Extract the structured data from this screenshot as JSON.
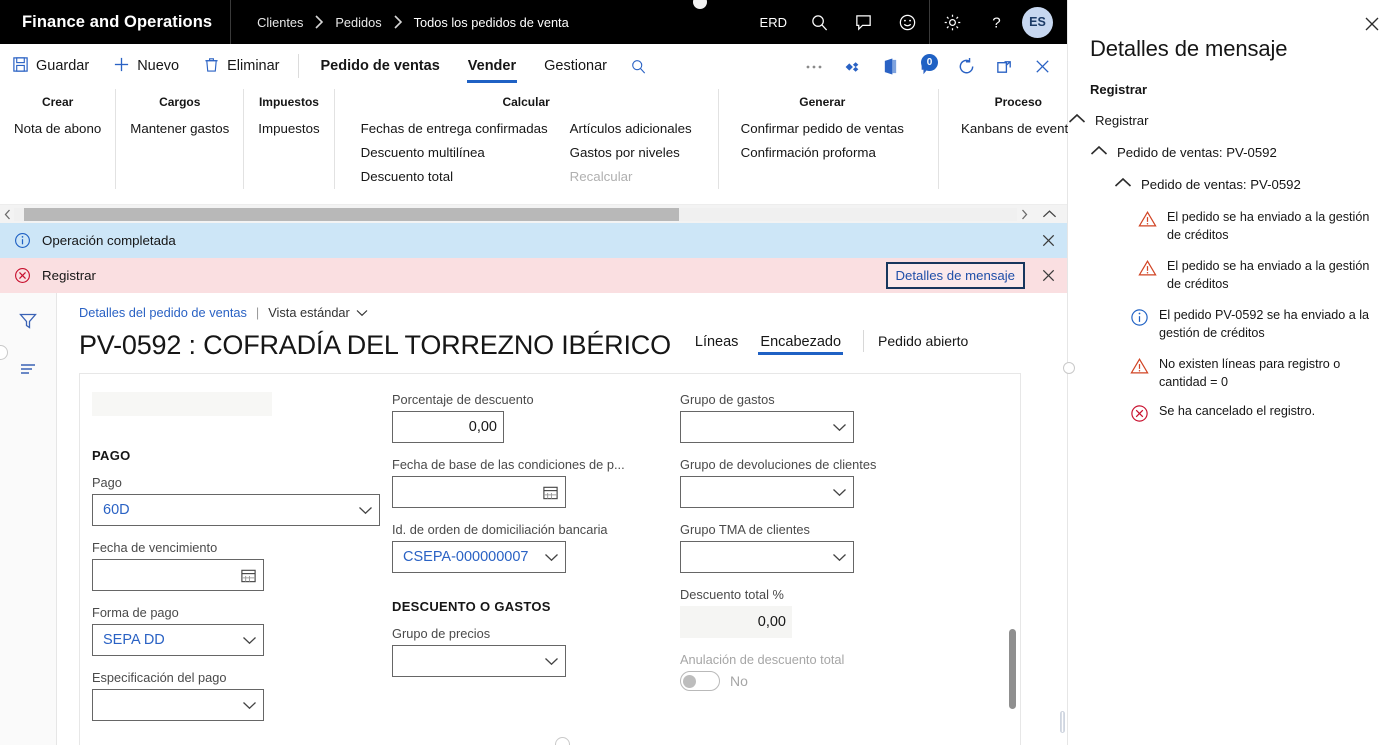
{
  "topbar": {
    "brand": "Finance and Operations",
    "breadcrumb": [
      "Clientes",
      "Pedidos",
      "Todos los pedidos de venta"
    ],
    "company": "ERD",
    "icons": [
      "search-icon",
      "feedback-icon",
      "smiley-icon",
      "settings-icon",
      "help-icon"
    ],
    "avatar_initials": "ES"
  },
  "actionpane": {
    "save": "Guardar",
    "new": "Nuevo",
    "delete": "Eliminar",
    "tabs": [
      {
        "label": "Pedido de ventas",
        "active": false
      },
      {
        "label": "Vender",
        "active": true
      },
      {
        "label": "Gestionar",
        "active": false
      }
    ],
    "notification_count": "0"
  },
  "ribbon": {
    "groups": [
      {
        "title": "Crear",
        "columns": [
          [
            "Nota de abono"
          ]
        ]
      },
      {
        "title": "Cargos",
        "columns": [
          [
            "Mantener gastos"
          ]
        ]
      },
      {
        "title": "Impuestos",
        "columns": [
          [
            "Impuestos"
          ]
        ]
      },
      {
        "title": "Calcular",
        "columns": [
          [
            "Fechas de entrega confirmadas",
            "Descuento multilínea",
            "Descuento total"
          ],
          [
            "Artículos adicionales",
            "Gastos por niveles",
            "Recalcular"
          ]
        ],
        "disabled": [
          "Recalcular"
        ]
      },
      {
        "title": "Generar",
        "columns": [
          [
            "Confirmar pedido de ventas",
            "Confirmación proforma"
          ]
        ]
      },
      {
        "title": "Proceso",
        "columns": [
          [
            "Kanbans de evento"
          ]
        ]
      }
    ]
  },
  "messagebars": [
    {
      "type": "info",
      "icon": "info-circle-icon",
      "text": "Operación completada",
      "bg": "#cde6f7"
    },
    {
      "type": "error",
      "icon": "error-circle-icon",
      "text": "Registrar",
      "bg": "#fadfe1",
      "action": "Detalles de mensaje"
    }
  ],
  "leftrail": {
    "icons": [
      "filter-icon",
      "lines-icon"
    ]
  },
  "page": {
    "caption_link": "Detalles del pedido de ventas",
    "caption_separator": "|",
    "view_selector": "Vista estándar",
    "title": "PV-0592 : COFRADÍA DEL TORREZNO IBÉRICO",
    "tabs": [
      {
        "label": "Líneas",
        "active": false
      },
      {
        "label": "Encabezado",
        "active": true
      }
    ],
    "status": "Pedido abierto"
  },
  "form": {
    "column1": {
      "section": "PAGO",
      "fields": [
        {
          "label": "Pago",
          "value": "60D",
          "control": "lookup"
        },
        {
          "label": "Fecha de vencimiento",
          "value": "",
          "control": "date"
        },
        {
          "label": "Forma de pago",
          "value": "SEPA DD",
          "control": "lookup"
        },
        {
          "label": "Especificación del pago",
          "value": "",
          "control": "lookup"
        }
      ]
    },
    "column2": {
      "section": "DESCUENTO O GASTOS",
      "fields_top": [
        {
          "label": "Porcentaje de descuento",
          "value": "0,00",
          "control": "number"
        },
        {
          "label": "Fecha de base de las condiciones de p...",
          "value": "",
          "control": "date"
        },
        {
          "label": "Id. de orden de domiciliación bancaria",
          "value": "CSEPA-000000007",
          "control": "lookup"
        }
      ],
      "fields_bottom": [
        {
          "label": "Grupo de precios",
          "value": "",
          "control": "lookup"
        }
      ]
    },
    "column3": {
      "fields": [
        {
          "label": "Grupo de gastos",
          "value": "",
          "control": "lookup"
        },
        {
          "label": "Grupo de devoluciones de clientes",
          "value": "",
          "control": "lookup"
        },
        {
          "label": "Grupo TMA de clientes",
          "value": "",
          "control": "lookup"
        },
        {
          "label": "Descuento total %",
          "value": "0,00",
          "control": "readonly"
        },
        {
          "label": "Anulación de descuento total",
          "value": "No",
          "control": "toggle",
          "disabled": true
        }
      ]
    }
  },
  "sidepanel": {
    "title": "Detalles de mensaje",
    "subtitle": "Registrar",
    "tree": [
      {
        "level": 1,
        "label": "Registrar"
      },
      {
        "level": 2,
        "label": "Pedido de ventas: PV-0592"
      },
      {
        "level": 3,
        "label": "Pedido de ventas: PV-0592"
      }
    ],
    "messages": [
      {
        "icon": "warning-triangle-icon",
        "text": "El pedido se ha enviado a la gestión de créditos"
      },
      {
        "icon": "warning-triangle-icon",
        "text": "El pedido se ha enviado a la gestión de créditos"
      },
      {
        "icon": "info-circle-icon",
        "text": "El pedido PV-0592 se ha enviado a la gestión de créditos"
      },
      {
        "icon": "warning-triangle-icon",
        "text": "No existen líneas para registro o cantidad = 0"
      },
      {
        "icon": "error-circle-icon",
        "text": "Se ha cancelado el registro."
      }
    ]
  },
  "colors": {
    "accent": "#1f61c4",
    "link": "#2a62c4",
    "info_bar": "#cde6f7",
    "error_bar": "#fadfe1",
    "warning": "#d14424",
    "error": "#c8102e",
    "topbar_bg": "#000000"
  }
}
